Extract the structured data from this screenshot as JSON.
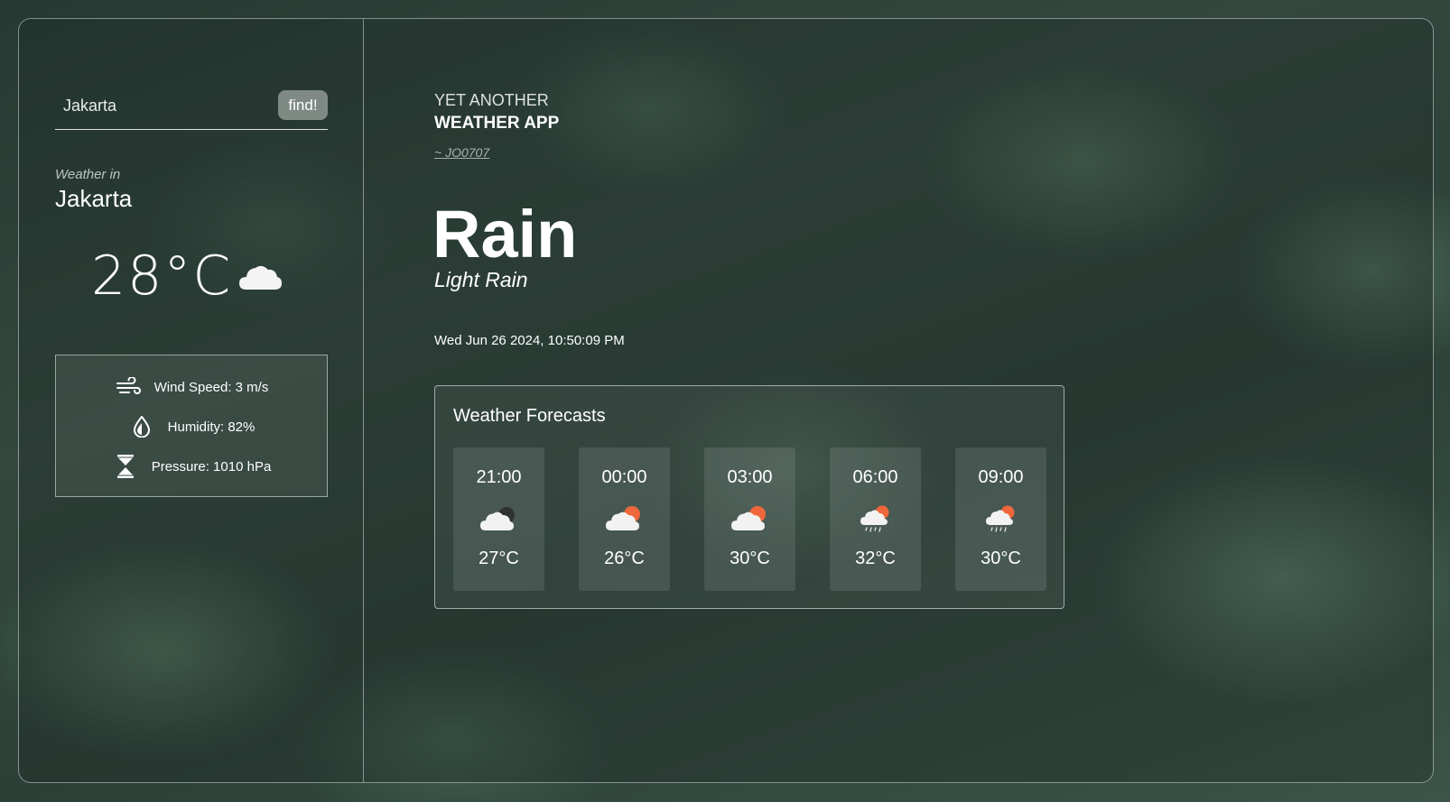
{
  "search": {
    "value": "Jakarta",
    "placeholder": "Jakarta",
    "button_label": "find!"
  },
  "current": {
    "weather_in_label": "Weather in",
    "city": "Jakarta",
    "temperature": "28°C",
    "icon": "cloud-icon"
  },
  "details": {
    "wind": {
      "label": "Wind Speed: 3 m/s",
      "icon": "wind-icon"
    },
    "humidity": {
      "label": "Humidity: 82%",
      "icon": "humidity-drop-icon"
    },
    "pressure": {
      "label": "Pressure: 1010 hPa",
      "icon": "pressure-icon"
    }
  },
  "header": {
    "line1": "YET ANOTHER",
    "line2": "WEATHER APP",
    "author": "~ JO0707"
  },
  "condition": {
    "main": "Rain",
    "description": "Light Rain"
  },
  "datetime": "Wed Jun 26 2024, 10:50:09 PM",
  "forecast": {
    "title": "Weather Forecasts",
    "items": [
      {
        "time": "21:00",
        "temp": "27°C",
        "icon": "cloud-moon-icon"
      },
      {
        "time": "00:00",
        "temp": "26°C",
        "icon": "cloud-sun-icon"
      },
      {
        "time": "03:00",
        "temp": "30°C",
        "icon": "cloud-sun-icon"
      },
      {
        "time": "06:00",
        "temp": "32°C",
        "icon": "cloud-sun-rain-icon"
      },
      {
        "time": "09:00",
        "temp": "30°C",
        "icon": "cloud-sun-rain-icon"
      }
    ]
  },
  "colors": {
    "sun": "#f0673b",
    "moon": "#2f3432",
    "cloud": "#f2f2f2"
  }
}
